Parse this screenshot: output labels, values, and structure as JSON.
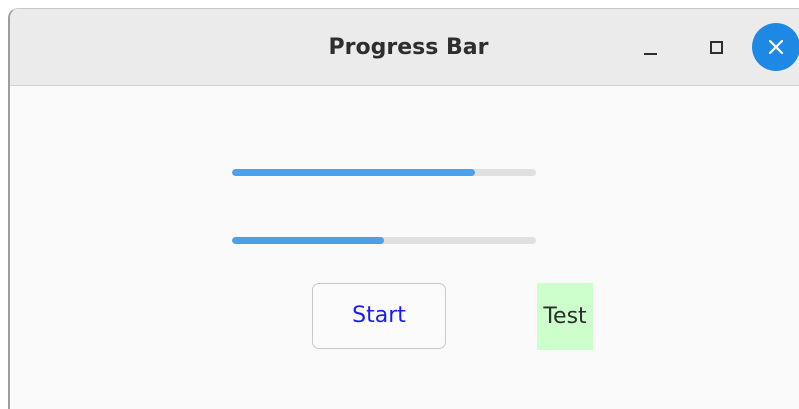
{
  "window": {
    "title": "Progress Bar",
    "controls": {
      "minimize_icon": "minimize-icon",
      "maximize_icon": "maximize-icon",
      "close_icon": "close-icon",
      "close_color": "#1e88e5"
    }
  },
  "progress_bars": [
    {
      "value": 0.8
    },
    {
      "value": 0.5
    }
  ],
  "start_button": {
    "label": "Start",
    "color": "#1a1aff"
  },
  "test_label": {
    "text": "Test",
    "background": "#ccffcc"
  },
  "colors": {
    "progress_fill": "#4ba1e8",
    "progress_trough": "#e0e0e0"
  }
}
